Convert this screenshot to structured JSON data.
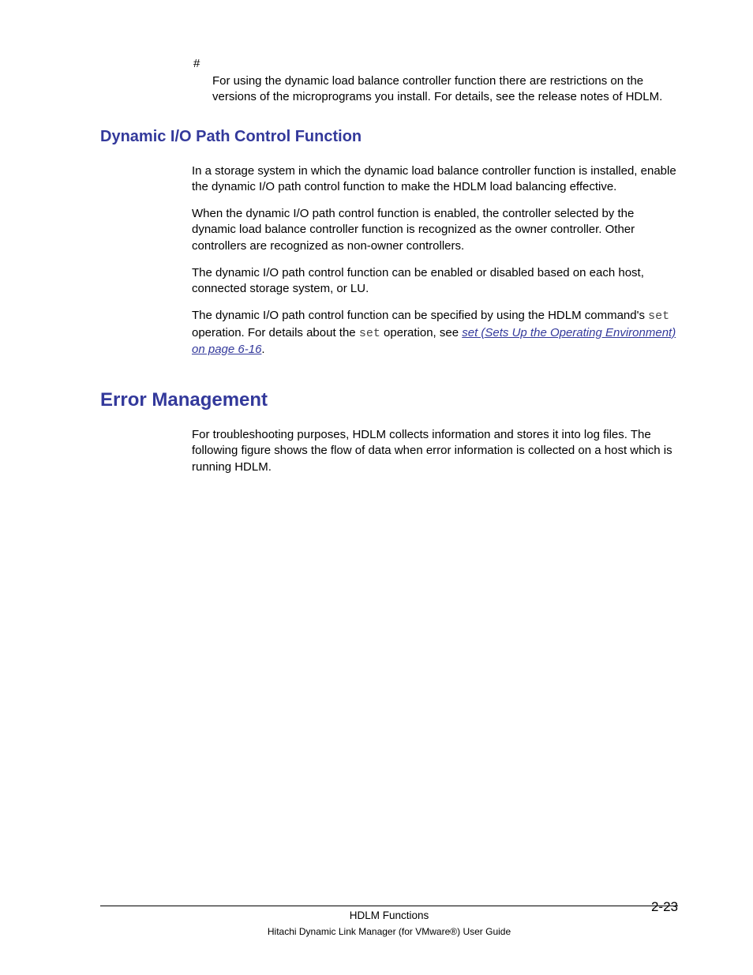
{
  "note": {
    "marker": "#",
    "body": "For using the dynamic load balance controller function there are restrictions on the versions of the microprograms you install. For details, see the release notes of HDLM."
  },
  "section1": {
    "heading": "Dynamic I/O Path Control Function",
    "p1": "In a storage system in which the dynamic load balance controller function is installed, enable the dynamic I/O path control function to make the HDLM load balancing effective.",
    "p2": "When the dynamic I/O path control function is enabled, the controller selected by the dynamic load balance controller function is recognized as the owner controller. Other controllers are recognized as non-owner controllers.",
    "p3": "The dynamic I/O path control function can be enabled or disabled based on each host, connected storage system, or LU.",
    "p4_a": "The dynamic I/O path control function can be specified by using the HDLM command's ",
    "p4_code1": "set",
    "p4_b": " operation. For details about the ",
    "p4_code2": "set",
    "p4_c": " operation, see ",
    "p4_link": "set (Sets Up the Operating Environment) on page 6-16",
    "p4_d": "."
  },
  "section2": {
    "heading": "Error Management",
    "p1": "For troubleshooting purposes, HDLM collects information and stores it into log files. The following figure shows the flow of data when error information is collected on a host which is running HDLM."
  },
  "footer": {
    "section_title": "HDLM Functions",
    "book_title": "Hitachi Dynamic Link Manager (for VMware®) User Guide",
    "page_number": "2-23"
  }
}
